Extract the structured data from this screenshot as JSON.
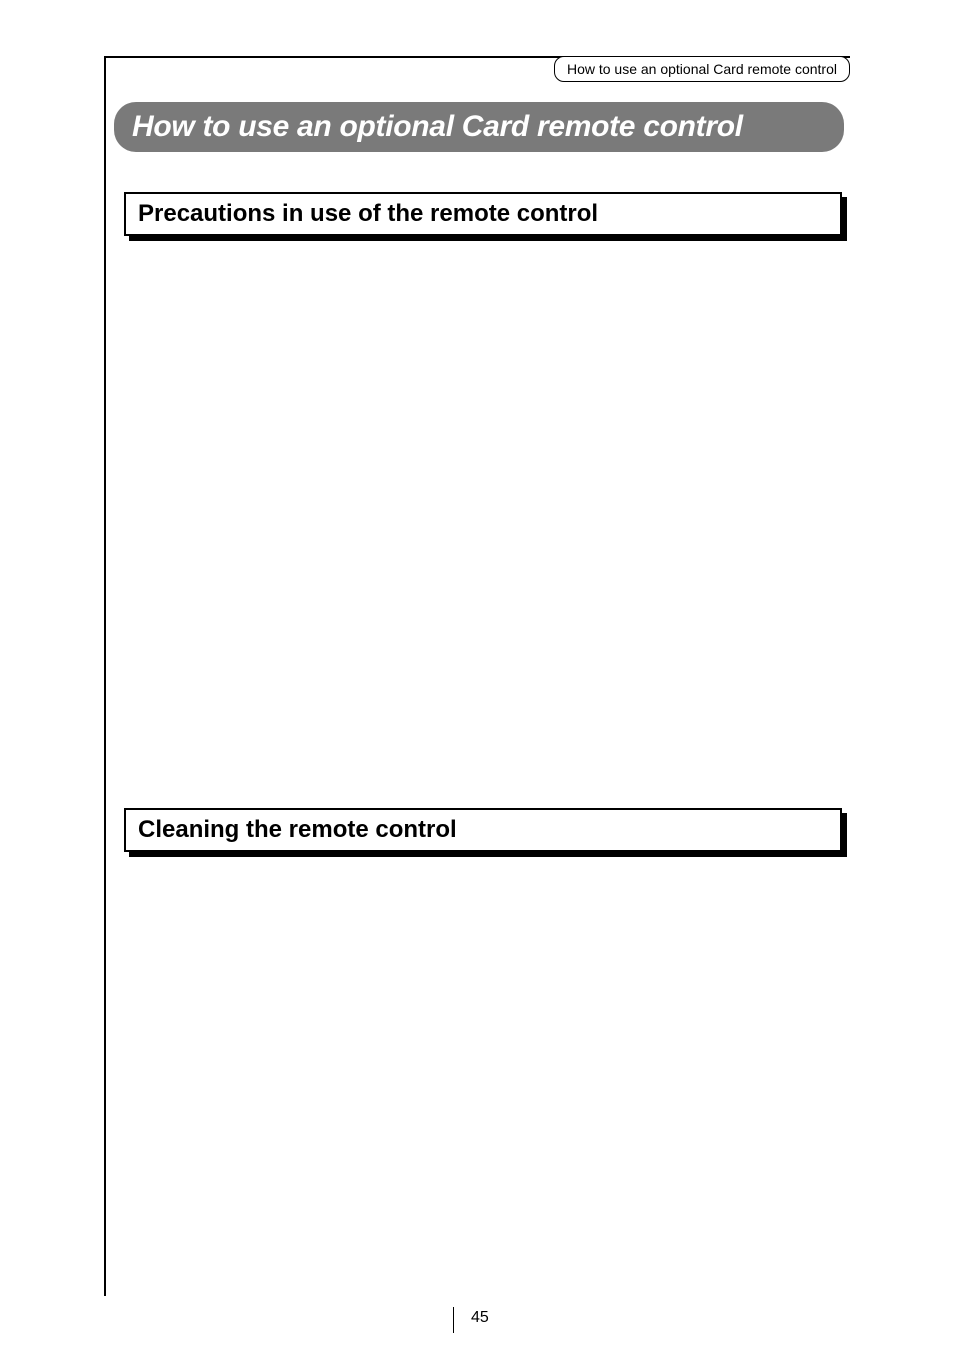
{
  "header_tab": "How to use an optional Card remote control",
  "title": "How to use an optional Card remote control",
  "sections": {
    "precautions": "Precautions in use of the remote control",
    "cleaning": "Cleaning the remote control"
  },
  "page_number": "45"
}
